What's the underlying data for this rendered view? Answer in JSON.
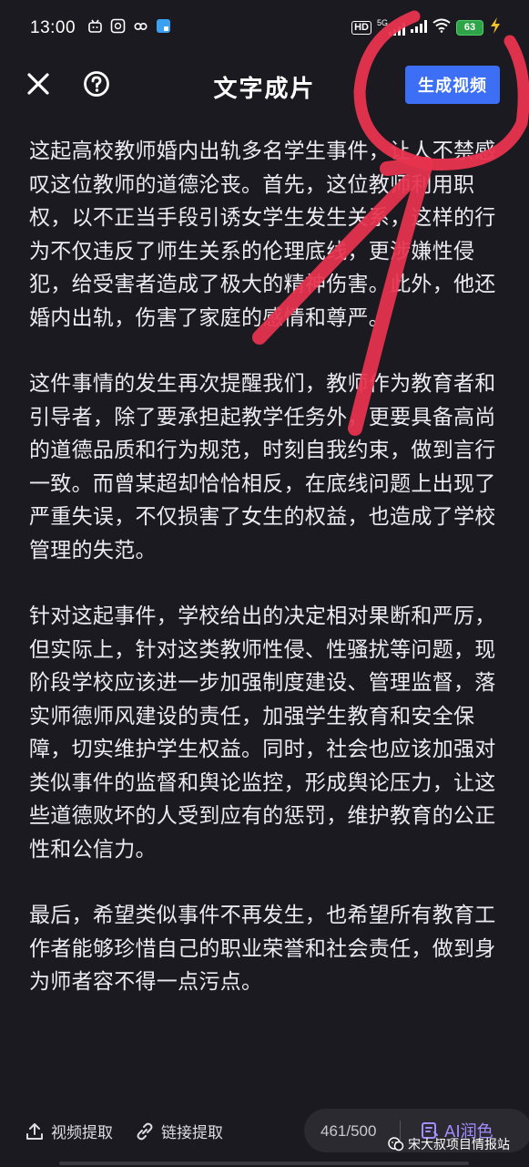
{
  "status_bar": {
    "time": "13:00",
    "hd_badge": "HD",
    "network": "5G",
    "battery": "63",
    "icons": [
      "app-icon-1",
      "app-icon-2",
      "app-icon-3",
      "app-icon-4",
      "signal-icon",
      "wifi-icon",
      "charging-icon"
    ]
  },
  "header": {
    "title": "文字成片",
    "generate_button": "生成视频",
    "close_icon": "close-icon",
    "help_icon": "help-icon"
  },
  "paragraphs": [
    "这起高校教师婚内出轨多名学生事件，让人不禁感叹这位教师的道德沦丧。首先，这位教师利用职权，以不正当手段引诱女学生发生关系，这样的行为不仅违反了师生关系的伦理底线，更涉嫌性侵犯，给受害者造成了极大的精神伤害。此外，他还婚内出轨，伤害了家庭的感情和尊严。",
    "这件事情的发生再次提醒我们，教师作为教育者和引导者，除了要承担起教学任务外，更要具备高尚的道德品质和行为规范，时刻自我约束，做到言行一致。而曾某超却恰恰相反，在底线问题上出现了严重失误，不仅损害了女生的权益，也造成了学校管理的失范。",
    "针对这起事件，学校给出的决定相对果断和严厉，但实际上，针对这类教师性侵、性骚扰等问题，现阶段学校应该进一步加强制度建设、管理监督，落实师德师风建设的责任，加强学生教育和安全保障，切实维护学生权益。同时，社会也应该加强对类似事件的监督和舆论监控，形成舆论压力，让这些道德败坏的人受到应有的惩罚，维护教育的公正性和公信力。",
    "最后，希望类似事件不再发生，也希望所有教育工作者能够珍惜自己的职业荣誉和社会责任，做到身为师者容不得一点污点。"
  ],
  "bottom_bar": {
    "video_extract": "视频提取",
    "link_extract": "链接提取",
    "char_count": "461/500",
    "ai_polish": "AI润色"
  },
  "watermark": "宋大叔项目情报站",
  "colors": {
    "background": "#1b1a20",
    "accent": "#3c6ff6",
    "ai_purple": "#a58cff",
    "annotation": "#e8334f"
  }
}
